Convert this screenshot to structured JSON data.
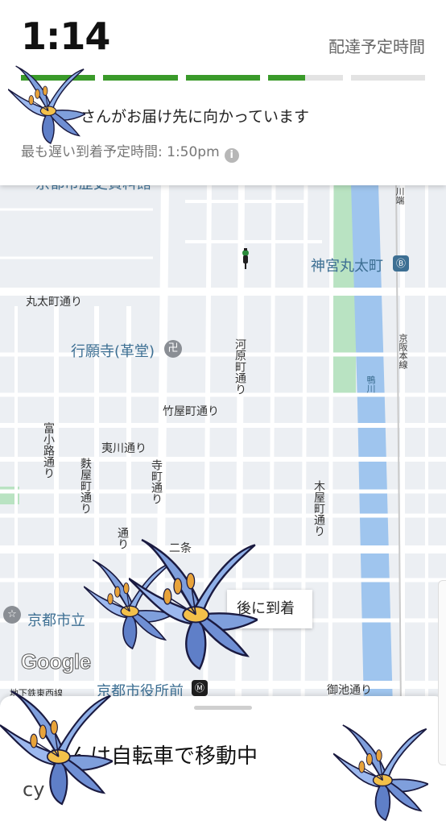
{
  "header": {
    "time": "1:14",
    "eta_label": "配達予定時間",
    "status_text": "さんがお届け先に向かっています",
    "latest_arrival": "最も遅い到着予定時間: 1:50pm",
    "info_icon": "i",
    "progress": {
      "completed_segments": 3,
      "active_fraction": 0.5,
      "total_segments": 5,
      "done_color": "#3a9a2a",
      "pending_color": "#e3e3e3"
    }
  },
  "map": {
    "labels": {
      "top_partial": "京都市歴史資料館",
      "jingu": "神宮丸太町",
      "marutamachi": "丸太町通り",
      "gyoganji": "行願寺(革堂)",
      "kawaramachi": "河原町通り",
      "takeyamachi": "竹屋町通り",
      "ebisugawa": "夷川通り",
      "teramachi": "寺町通り",
      "fuyacho": "麩屋町通り",
      "tominokoji": "富小路通り",
      "kiyamachi": "木屋町通り",
      "nijo": "二条",
      "kyoto_lib": "京都市立",
      "sakaimachi": "通り",
      "kawabata": "川端",
      "keihan": "京阪本線",
      "kamo": "鴨川",
      "shiyakusho": "京都市役所前",
      "oike": "御池通り",
      "subway": "地下鉄東西線"
    },
    "icons": {
      "temple": "卍",
      "poi": "☆",
      "station": "Ⓑ",
      "subway": "Ⓜ"
    },
    "google": "Google",
    "arrive_chip": "後に到着"
  },
  "sheet": {
    "courier_status": "さんは自転車で移動中",
    "courier_sub": "cy"
  }
}
